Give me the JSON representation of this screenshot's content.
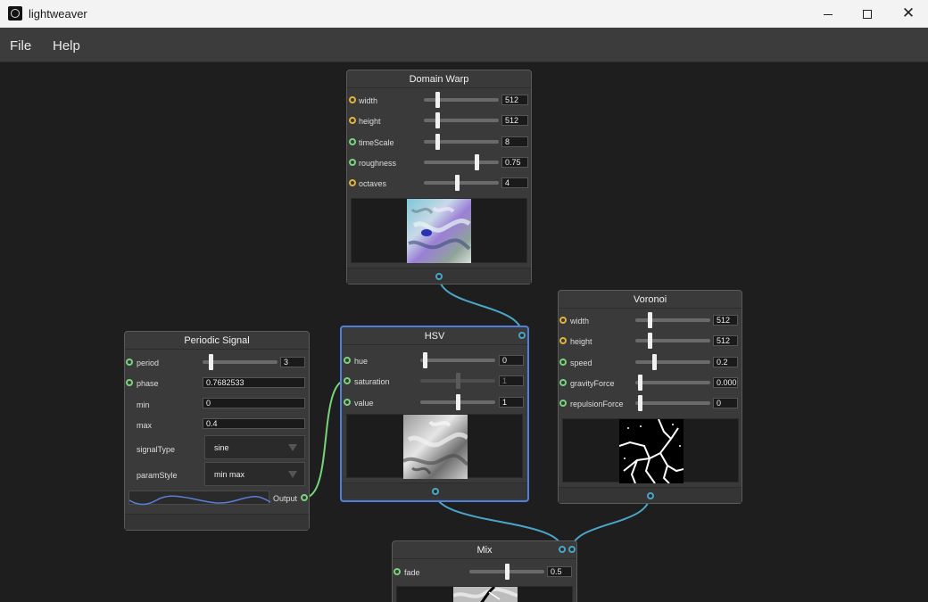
{
  "window": {
    "title": "lightweaver"
  },
  "menu": {
    "file": "File",
    "help": "Help"
  },
  "nodes": {
    "domain_warp": {
      "title": "Domain Warp",
      "params": [
        {
          "label": "width",
          "value": "512",
          "port": "yellow",
          "level": 0.13
        },
        {
          "label": "height",
          "value": "512",
          "port": "yellow",
          "level": 0.13
        },
        {
          "label": "timeScale",
          "value": "8",
          "port": "green",
          "level": 0.13
        },
        {
          "label": "roughness",
          "value": "0.75",
          "port": "green",
          "level": 0.73
        },
        {
          "label": "octaves",
          "value": "4",
          "port": "yellow",
          "level": 0.43
        }
      ]
    },
    "voronoi": {
      "title": "Voronoi",
      "params": [
        {
          "label": "width",
          "value": "512",
          "port": "yellow",
          "level": 0.15
        },
        {
          "label": "height",
          "value": "512",
          "port": "yellow",
          "level": 0.15
        },
        {
          "label": "speed",
          "value": "0.2",
          "port": "green",
          "level": 0.22
        },
        {
          "label": "gravityForce",
          "value": "0.000",
          "port": "green",
          "level": 0.0
        },
        {
          "label": "repulsionForce",
          "value": "0",
          "port": "green",
          "level": 0.0
        }
      ]
    },
    "hsv": {
      "title": "HSV",
      "params": [
        {
          "label": "hue",
          "value": "0",
          "port": "green",
          "level": 0.0,
          "dim": false
        },
        {
          "label": "saturation",
          "value": "1",
          "port": "green",
          "level": 0.5,
          "dim": true
        },
        {
          "label": "value",
          "value": "1",
          "port": "green",
          "level": 0.5,
          "dim": false
        }
      ]
    },
    "periodic_signal": {
      "title": "Periodic Signal",
      "period": {
        "label": "period",
        "value": "3",
        "level": 0.06
      },
      "phase": {
        "label": "phase",
        "value": "0.7682533"
      },
      "min": {
        "label": "min",
        "value": "0"
      },
      "max": {
        "label": "max",
        "value": "0.4"
      },
      "signal_type": {
        "label": "signalType",
        "value": "sine"
      },
      "param_style": {
        "label": "paramStyle",
        "value": "min max"
      },
      "output_label": "Output"
    },
    "mix": {
      "title": "Mix",
      "params": [
        {
          "label": "fade",
          "value": "0.5",
          "port": "green",
          "level": 0.5
        }
      ]
    }
  },
  "colors": {
    "port_yellow": "#e2b23a",
    "port_green": "#79d37a",
    "port_blue": "#4aa6c7",
    "wire_blue": "#4aa6c7",
    "wire_green": "#79d37a",
    "selection": "#4f7fd9"
  }
}
